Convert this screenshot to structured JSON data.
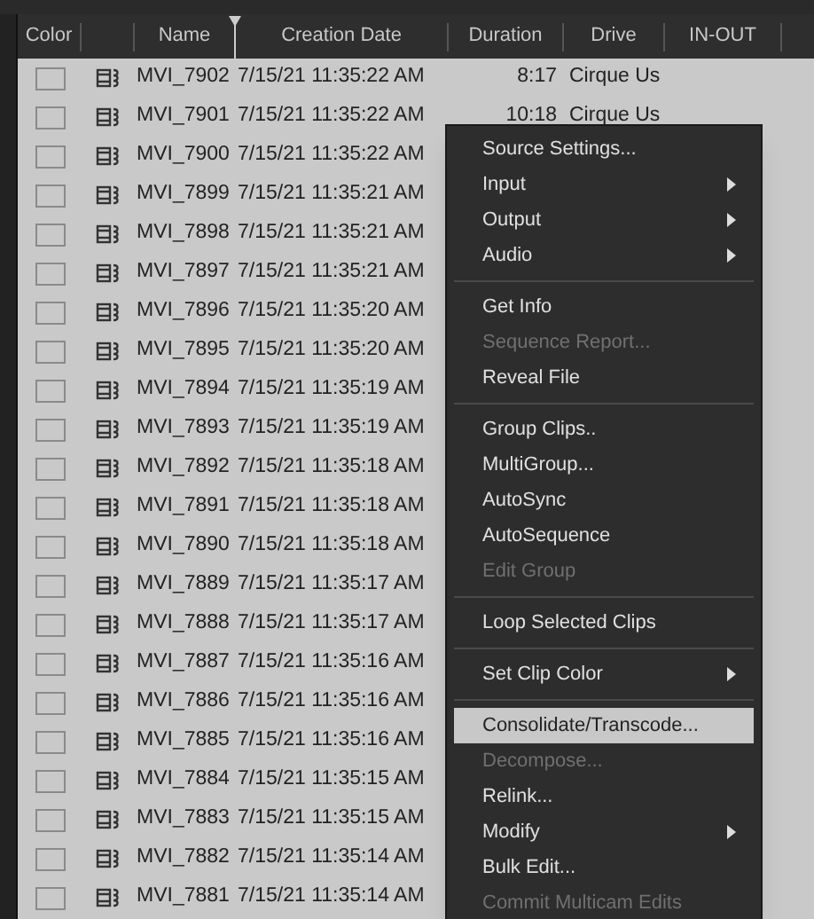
{
  "columns": [
    "Color",
    "",
    "Name",
    "Creation Date",
    "Duration",
    "Drive",
    "IN-OUT"
  ],
  "rows": [
    {
      "name": "MVI_7902",
      "date": "7/15/21 11:35:22 AM",
      "duration": "8:17",
      "drive": "Cirque Us"
    },
    {
      "name": "MVI_7901",
      "date": "7/15/21 11:35:22 AM",
      "duration": "10:18",
      "drive": "Cirque Us"
    },
    {
      "name": "MVI_7900",
      "date": "7/15/21 11:35:22 AM"
    },
    {
      "name": "MVI_7899",
      "date": "7/15/21 11:35:21 AM"
    },
    {
      "name": "MVI_7898",
      "date": "7/15/21 11:35:21 AM"
    },
    {
      "name": "MVI_7897",
      "date": "7/15/21 11:35:21 AM"
    },
    {
      "name": "MVI_7896",
      "date": "7/15/21 11:35:20 AM"
    },
    {
      "name": "MVI_7895",
      "date": "7/15/21 11:35:20 AM"
    },
    {
      "name": "MVI_7894",
      "date": "7/15/21 11:35:19 AM"
    },
    {
      "name": "MVI_7893",
      "date": "7/15/21 11:35:19 AM"
    },
    {
      "name": "MVI_7892",
      "date": "7/15/21 11:35:18 AM"
    },
    {
      "name": "MVI_7891",
      "date": "7/15/21 11:35:18 AM"
    },
    {
      "name": "MVI_7890",
      "date": "7/15/21 11:35:18 AM"
    },
    {
      "name": "MVI_7889",
      "date": "7/15/21 11:35:17 AM"
    },
    {
      "name": "MVI_7888",
      "date": "7/15/21 11:35:17 AM"
    },
    {
      "name": "MVI_7887",
      "date": "7/15/21 11:35:16 AM"
    },
    {
      "name": "MVI_7886",
      "date": "7/15/21 11:35:16 AM"
    },
    {
      "name": "MVI_7885",
      "date": "7/15/21 11:35:16 AM"
    },
    {
      "name": "MVI_7884",
      "date": "7/15/21 11:35:15 AM"
    },
    {
      "name": "MVI_7883",
      "date": "7/15/21 11:35:15 AM"
    },
    {
      "name": "MVI_7882",
      "date": "7/15/21 11:35:14 AM"
    },
    {
      "name": "MVI_7881",
      "date": "7/15/21 11:35:14 AM"
    }
  ],
  "context_menu": [
    {
      "kind": "item",
      "label": "Source Settings...",
      "disabled": false,
      "submenu": false,
      "selected": false
    },
    {
      "kind": "item",
      "label": "Input",
      "disabled": false,
      "submenu": true,
      "selected": false
    },
    {
      "kind": "item",
      "label": "Output",
      "disabled": false,
      "submenu": true,
      "selected": false
    },
    {
      "kind": "item",
      "label": "Audio",
      "disabled": false,
      "submenu": true,
      "selected": false
    },
    {
      "kind": "separator"
    },
    {
      "kind": "item",
      "label": "Get Info",
      "disabled": false,
      "submenu": false,
      "selected": false
    },
    {
      "kind": "item",
      "label": "Sequence Report...",
      "disabled": true,
      "submenu": false,
      "selected": false
    },
    {
      "kind": "item",
      "label": "Reveal File",
      "disabled": false,
      "submenu": false,
      "selected": false
    },
    {
      "kind": "separator"
    },
    {
      "kind": "item",
      "label": "Group Clips..",
      "disabled": false,
      "submenu": false,
      "selected": false
    },
    {
      "kind": "item",
      "label": "MultiGroup...",
      "disabled": false,
      "submenu": false,
      "selected": false
    },
    {
      "kind": "item",
      "label": "AutoSync",
      "disabled": false,
      "submenu": false,
      "selected": false
    },
    {
      "kind": "item",
      "label": "AutoSequence",
      "disabled": false,
      "submenu": false,
      "selected": false
    },
    {
      "kind": "item",
      "label": "Edit Group",
      "disabled": true,
      "submenu": false,
      "selected": false
    },
    {
      "kind": "separator"
    },
    {
      "kind": "item",
      "label": "Loop Selected Clips",
      "disabled": false,
      "submenu": false,
      "selected": false
    },
    {
      "kind": "separator"
    },
    {
      "kind": "item",
      "label": "Set Clip Color",
      "disabled": false,
      "submenu": true,
      "selected": false
    },
    {
      "kind": "separator"
    },
    {
      "kind": "item",
      "label": "Consolidate/Transcode...",
      "disabled": false,
      "submenu": false,
      "selected": true
    },
    {
      "kind": "item",
      "label": "Decompose...",
      "disabled": true,
      "submenu": false,
      "selected": false
    },
    {
      "kind": "item",
      "label": "Relink...",
      "disabled": false,
      "submenu": false,
      "selected": false
    },
    {
      "kind": "item",
      "label": "Modify",
      "disabled": false,
      "submenu": true,
      "selected": false
    },
    {
      "kind": "item",
      "label": "Bulk Edit...",
      "disabled": false,
      "submenu": false,
      "selected": false
    },
    {
      "kind": "item",
      "label": "Commit Multicam Edits",
      "disabled": true,
      "submenu": false,
      "selected": false
    }
  ]
}
